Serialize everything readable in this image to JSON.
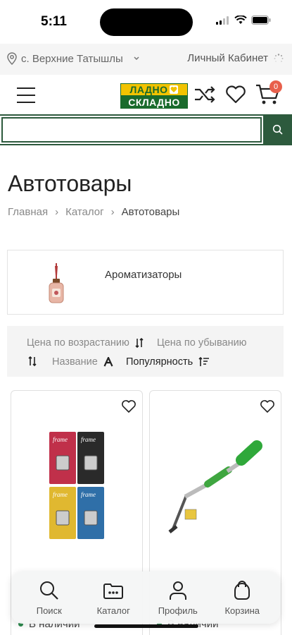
{
  "status_bar": {
    "time": "5:11"
  },
  "location": {
    "city": "с. Верхние Татышлы",
    "account_label": "Личный Кабинет"
  },
  "header": {
    "logo_top": "ЛАДНО",
    "logo_bottom": "СКЛАДНО",
    "cart_count": "0"
  },
  "search": {
    "placeholder": "",
    "value": ""
  },
  "page": {
    "title": "Автотовары"
  },
  "breadcrumb": [
    {
      "label": "Главная"
    },
    {
      "label": "Каталог"
    },
    {
      "label": "Автотовары"
    }
  ],
  "category": {
    "label": "Ароматизаторы"
  },
  "sort": {
    "price_asc": "Цена по возрастанию",
    "price_desc": "Цена по убыванию",
    "name": "Название",
    "popularity": "Популярность",
    "active": "popularity"
  },
  "products": [
    {
      "stock": "В наличии",
      "image": "car-air-freshener-set"
    },
    {
      "stock": "В наличии",
      "image": "snow-brush-scraper"
    }
  ],
  "tabbar": {
    "search": "Поиск",
    "catalog": "Каталог",
    "profile": "Профиль",
    "cart": "Корзина"
  },
  "colors": {
    "brand_green": "#2d5a3d",
    "brand_yellow": "#f2c300",
    "badge": "#e8604c",
    "stock_dot": "#2d8a4e"
  }
}
